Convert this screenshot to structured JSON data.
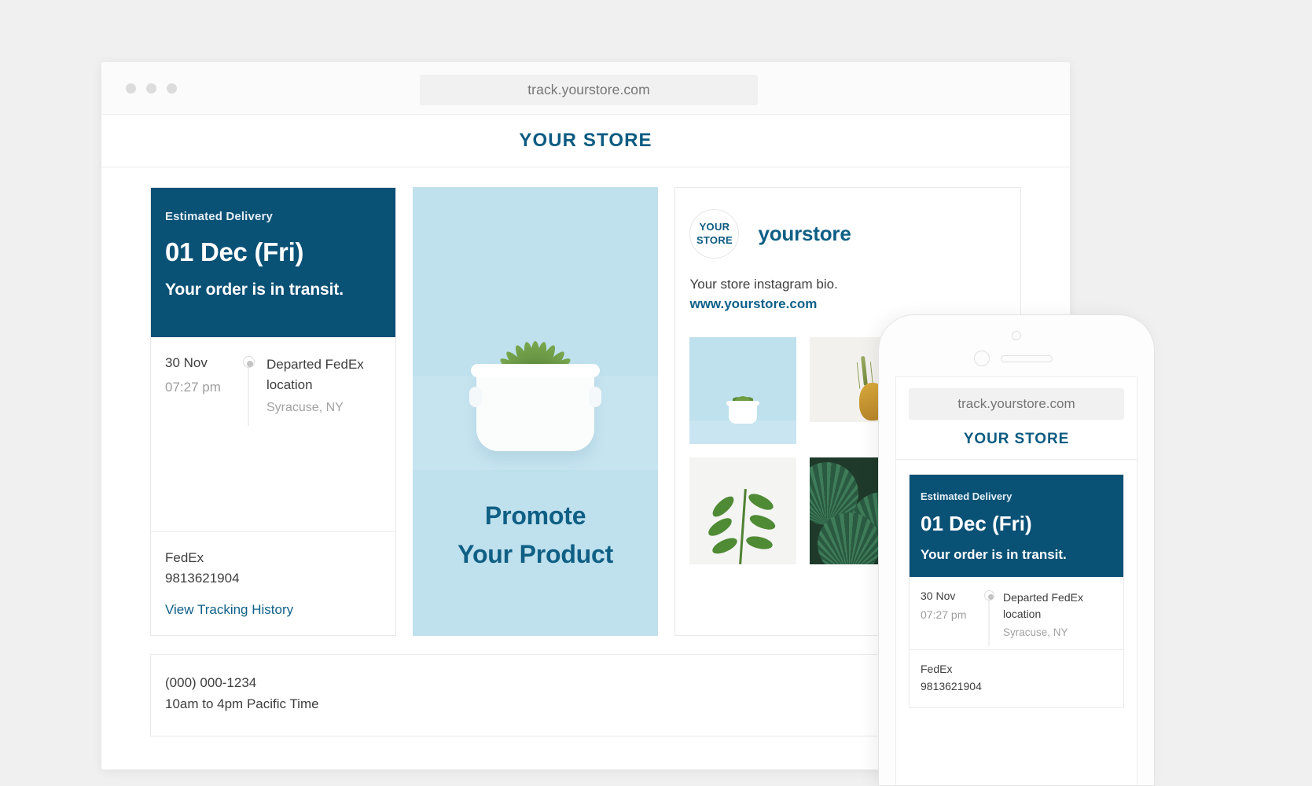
{
  "browser": {
    "url": "track.yourstore.com",
    "traffic_lights": [
      "close",
      "minimize",
      "maximize"
    ]
  },
  "store": {
    "name": "YOUR STORE",
    "logo_line1": "YOUR",
    "logo_line2": "STORE"
  },
  "tracking": {
    "estimated_label": "Estimated Delivery",
    "estimated_date": "01 Dec (Fri)",
    "status": "Your order is in transit.",
    "events": [
      {
        "date": "30 Nov",
        "time": "07:27 pm",
        "title": "Departed FedEx location",
        "place": "Syracuse, NY"
      }
    ],
    "carrier": "FedEx",
    "tracking_number": "9813621904",
    "history_link": "View Tracking History"
  },
  "promo": {
    "line1": "Promote",
    "line2": "Your Product"
  },
  "instagram": {
    "handle": "yourstore",
    "bio": "Your store instagram bio.",
    "website": "www.yourstore.com",
    "tiles": [
      "succulent-in-white-pot-blue-background",
      "pineapple-on-white-shelf",
      "green-plant-sprig-on-white",
      "dark-green-palm-leaves"
    ]
  },
  "contact": {
    "phone": "(000) 000-1234",
    "hours": "10am to 4pm Pacific Time"
  },
  "phone_preview": {
    "url": "track.yourstore.com",
    "store_name": "YOUR STORE",
    "estimated_label": "Estimated Delivery",
    "estimated_date": "01 Dec (Fri)",
    "status": "Your order is in transit.",
    "event_date": "30 Nov",
    "event_time": "07:27 pm",
    "event_title": "Departed FedEx location",
    "event_place": "Syracuse, NY",
    "carrier": "FedEx",
    "tracking_number": "9813621904"
  },
  "colors": {
    "brand_dark_blue": "#0a5176",
    "brand_blue": "#0f5f85",
    "promo_bg": "#bfe0ed",
    "page_bg": "#f0f0f0"
  }
}
